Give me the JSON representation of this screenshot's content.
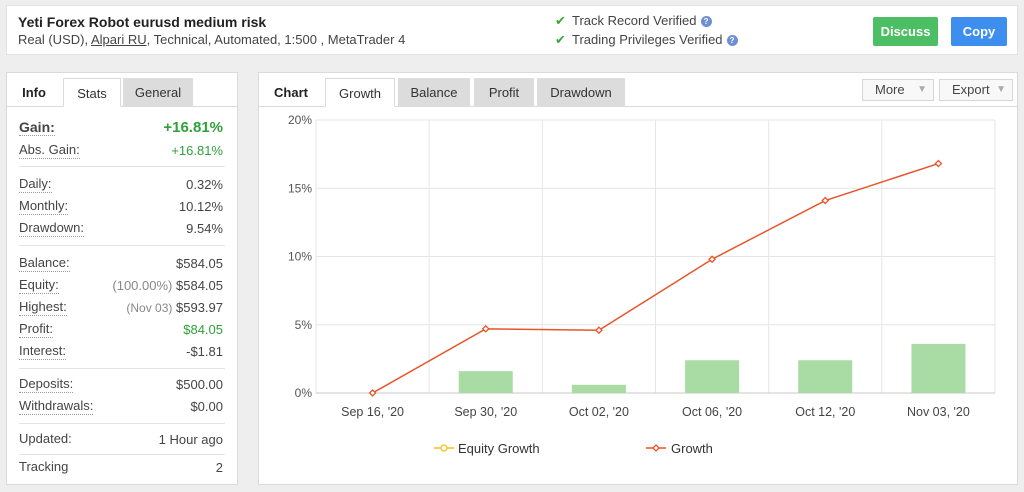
{
  "header": {
    "title": "Yeti Forex Robot eurusd medium risk",
    "subtitle_pre": "Real (USD),",
    "broker": "Alpari RU",
    "subtitle_post": ", Technical, Automated, 1:500 , MetaTrader 4",
    "track_record": "Track Record Verified",
    "trading_privileges": "Trading Privileges Verified",
    "discuss_label": "Discuss",
    "copy_label": "Copy"
  },
  "info": {
    "tabs": [
      "Info",
      "Stats",
      "General"
    ],
    "gain": {
      "label": "Gain:",
      "value": "+16.81%"
    },
    "abs_gain": {
      "label": "Abs. Gain:",
      "value": "+16.81%"
    },
    "daily": {
      "label": "Daily:",
      "value": "0.32%"
    },
    "monthly": {
      "label": "Monthly:",
      "value": "10.12%"
    },
    "drawdown": {
      "label": "Drawdown:",
      "value": "9.54%"
    },
    "balance": {
      "label": "Balance:",
      "value": "$584.05"
    },
    "equity": {
      "label": "Equity:",
      "note": "(100.00%)",
      "value": "$584.05"
    },
    "highest": {
      "label": "Highest:",
      "note": "(Nov 03)",
      "value": "$593.97"
    },
    "profit": {
      "label": "Profit:",
      "value": "$84.05"
    },
    "interest": {
      "label": "Interest:",
      "value": "-$1.81"
    },
    "deposits": {
      "label": "Deposits:",
      "value": "$500.00"
    },
    "withdrawals": {
      "label": "Withdrawals:",
      "value": "$0.00"
    },
    "updated": {
      "label": "Updated:",
      "value": "1 Hour ago"
    },
    "tracking": {
      "label": "Tracking",
      "value": "2"
    }
  },
  "chart_panel": {
    "tabs": [
      "Chart",
      "Growth",
      "Balance",
      "Profit",
      "Drawdown"
    ],
    "more_label": "More",
    "export_label": "Export"
  },
  "chart_data": {
    "type": "line",
    "categories": [
      "Sep 16, '20",
      "Sep 30, '20",
      "Oct 02, '20",
      "Oct 06, '20",
      "Oct 12, '20",
      "Nov 03, '20"
    ],
    "series": [
      {
        "name": "Equity Growth",
        "type": "bar",
        "values": [
          0,
          1.6,
          0.6,
          2.4,
          2.4,
          3.6
        ],
        "color": "#a9dba4"
      },
      {
        "name": "Growth",
        "type": "line",
        "values": [
          0,
          4.7,
          4.6,
          9.8,
          14.1,
          16.81
        ],
        "color": "#e8542a"
      }
    ],
    "y_ticks": [
      "0%",
      "5%",
      "10%",
      "15%",
      "20%"
    ],
    "ylim": [
      0,
      20
    ],
    "legend_position": "bottom",
    "legend_colors": {
      "equity_marker": "#f2c418",
      "growth_marker": "#e8542a"
    }
  }
}
